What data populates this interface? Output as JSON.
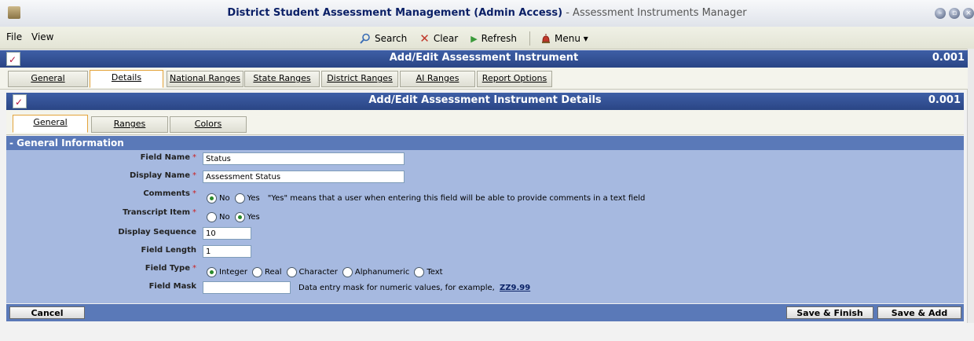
{
  "window": {
    "title_bold": "District Student Assessment Management (Admin Access)",
    "title_rest": " - Assessment Instruments Manager"
  },
  "menu": {
    "file": "File",
    "view": "View",
    "search": "Search",
    "clear": "Clear",
    "refresh": "Refresh",
    "menu": "Menu ▾"
  },
  "outer_panel": {
    "title": "Add/Edit Assessment Instrument",
    "value": "0.001"
  },
  "outer_tabs": [
    "General",
    "Details",
    "National Ranges",
    "State Ranges",
    "District Ranges",
    "AI Ranges",
    "Report Options"
  ],
  "inner_panel": {
    "title": "Add/Edit Assessment Instrument Details",
    "value": "0.001"
  },
  "inner_tabs": [
    "General",
    "Ranges",
    "Colors"
  ],
  "section": {
    "title": "- General Information"
  },
  "fields": {
    "field_name": {
      "label": "Field Name",
      "value": "Status"
    },
    "display_name": {
      "label": "Display Name",
      "value": "Assessment Status"
    },
    "comments": {
      "label": "Comments",
      "opt_no": "No",
      "opt_yes": "Yes",
      "selected": "No",
      "note": "\"Yes\" means that a user when entering this field will be able to provide comments in a text field"
    },
    "transcript_item": {
      "label": "Transcript Item",
      "opt_no": "No",
      "opt_yes": "Yes",
      "selected": "Yes"
    },
    "display_sequence": {
      "label": "Display Sequence",
      "value": "10"
    },
    "field_length": {
      "label": "Field Length",
      "value": "1"
    },
    "field_type": {
      "label": "Field Type",
      "options": [
        "Integer",
        "Real",
        "Character",
        "Alphanumeric",
        "Text"
      ],
      "selected": "Integer"
    },
    "field_mask": {
      "label": "Field Mask",
      "value": "",
      "note": "Data entry mask for numeric values, for example,",
      "example": "ZZ9.99"
    }
  },
  "actions": {
    "cancel": "Cancel",
    "save_finish": "Save & Finish",
    "save_add": "Save & Add"
  },
  "required_mark": "*",
  "colors": {
    "header": "#2a4585",
    "section": "#5a79b8",
    "form_bg": "#a6b9e0",
    "active_tab_border": "#e3a33a"
  }
}
